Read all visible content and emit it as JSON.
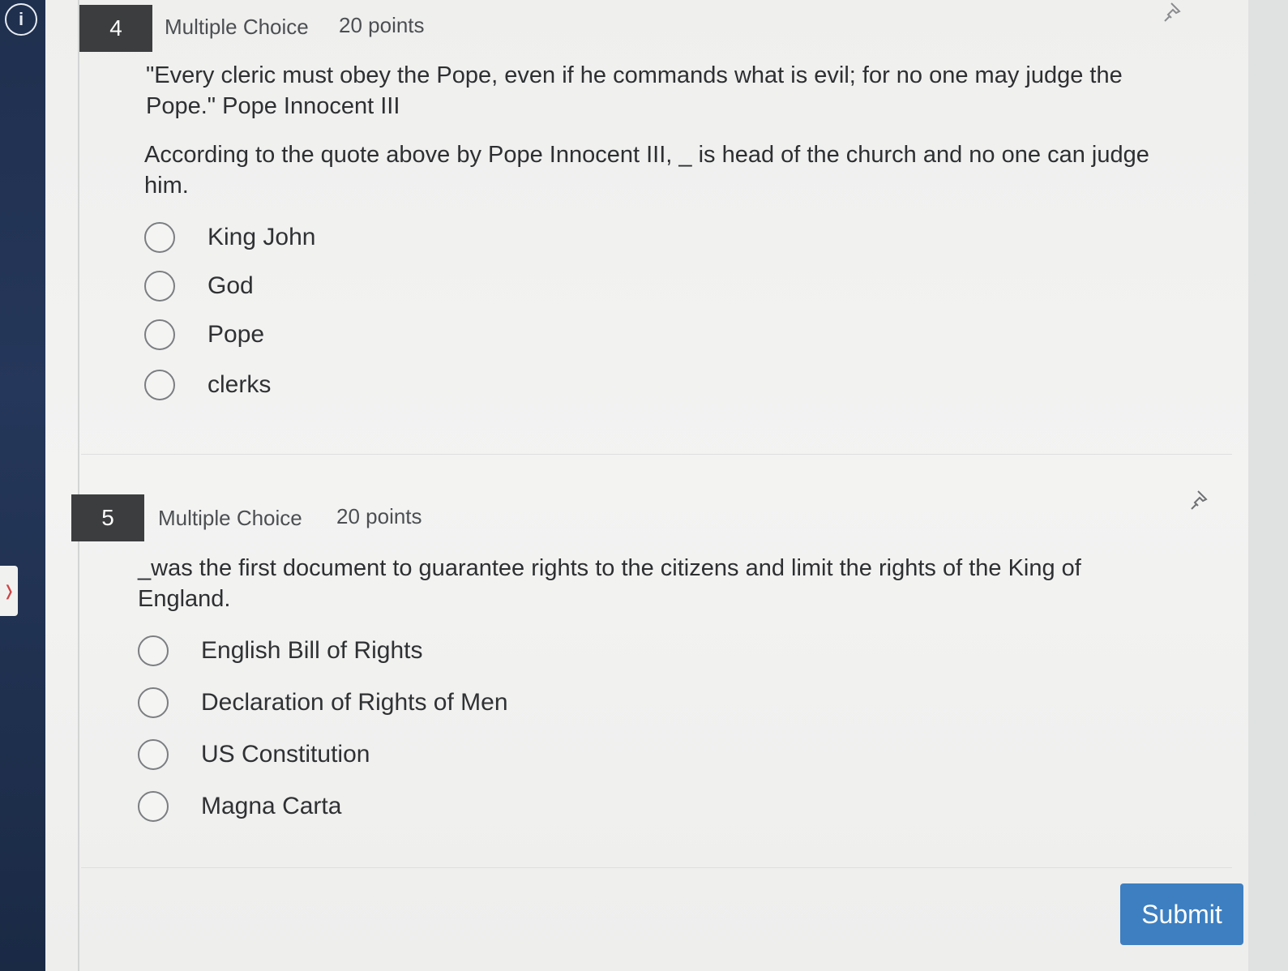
{
  "questions": [
    {
      "number": "4",
      "type": "Multiple Choice",
      "points": "20 points",
      "quote": "\"Every cleric must obey the Pope, even if he commands what is evil; for no one may judge the Pope.\" Pope Innocent III",
      "prompt": "According to the quote above by Pope Innocent III, _ is head of the church and no one can judge him.",
      "options": [
        "King John",
        "God",
        "Pope",
        "clerks"
      ]
    },
    {
      "number": "5",
      "type": "Multiple Choice",
      "points": "20 points",
      "prompt": "_was the first document to guarantee rights to the citizens and limit the rights of the King of England.",
      "options": [
        "English Bill of Rights",
        "Declaration of Rights of Men",
        "US Constitution",
        "Magna Carta"
      ]
    }
  ],
  "submit_label": "Submit",
  "icons": {
    "info": "info-icon",
    "pin": "pin-icon",
    "audio": "audio-icon"
  },
  "colors": {
    "sidebar": "#25375a",
    "question_badge": "#3c3d3f",
    "submit": "#3d7fc1"
  }
}
